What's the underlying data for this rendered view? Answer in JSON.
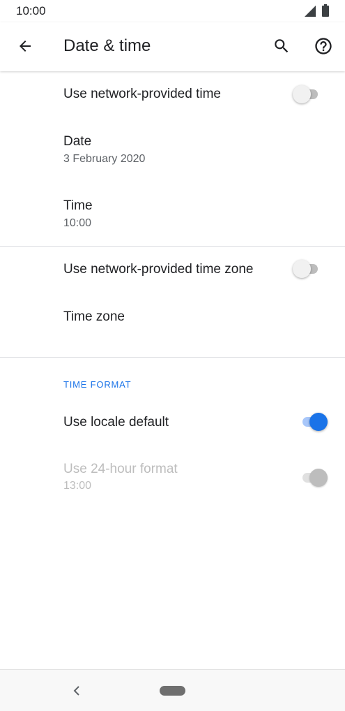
{
  "status_bar": {
    "time": "10:00",
    "icons": [
      "signal-icon",
      "battery-icon"
    ]
  },
  "app_bar": {
    "title": "Date & time",
    "icons": {
      "back": "arrow-back-icon",
      "search": "search-icon",
      "help": "help-icon"
    }
  },
  "network_time": {
    "title": "Use network-provided time",
    "enabled": false
  },
  "date": {
    "title": "Date",
    "summary": "3 February 2020"
  },
  "time": {
    "title": "Time",
    "summary": "10:00"
  },
  "network_zone": {
    "title": "Use network-provided time zone",
    "enabled": false
  },
  "time_zone": {
    "title": "Time zone"
  },
  "time_format": {
    "header": "TIME FORMAT",
    "locale_default": {
      "title": "Use locale default",
      "enabled": true
    },
    "hour24": {
      "title": "Use 24-hour format",
      "summary": "13:00",
      "enabled": true,
      "disabled": true
    }
  },
  "colors": {
    "accent": "#1a73e8",
    "text_primary": "#202124",
    "text_secondary": "#5f6368",
    "text_disabled": "#bdbdbd"
  },
  "nav_bar": {
    "icons": [
      "nav-back-icon",
      "home-pill"
    ]
  }
}
